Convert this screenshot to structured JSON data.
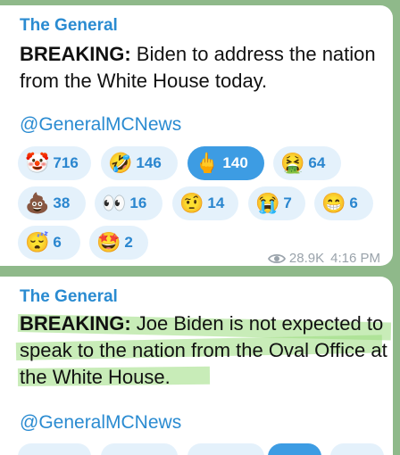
{
  "messages": [
    {
      "author": "The General",
      "text_bold": "BREAKING:",
      "text_rest": " Biden to address the nation from the White House today.",
      "handle": "@GeneralMCNews",
      "reactions": [
        {
          "emoji": "🤡",
          "count": "716"
        },
        {
          "emoji": "🤣",
          "count": "146"
        },
        {
          "emoji": "🖕",
          "count": "140",
          "active": true
        },
        {
          "emoji": "🤮",
          "count": "64"
        },
        {
          "emoji": "💩",
          "count": "38"
        },
        {
          "emoji": "👀",
          "count": "16"
        },
        {
          "emoji": "🤨",
          "count": "14"
        },
        {
          "emoji": "😭",
          "count": "7"
        },
        {
          "emoji": "😁",
          "count": "6"
        },
        {
          "emoji": "😴",
          "count": "6"
        },
        {
          "emoji": "🤩",
          "count": "2"
        }
      ],
      "views": "28.9K",
      "time": "4:16 PM"
    },
    {
      "author": "The General",
      "text_bold": "BREAKING:",
      "text_rest": " Joe Biden is not expected to speak to the nation from the Oval Office at the White House.",
      "handle": "@GeneralMCNews"
    }
  ],
  "colors": {
    "accent": "#2a8bd1",
    "reaction_bg": "#e4f1fb",
    "reaction_active": "#3d9ce3",
    "highlight": "#9bdc7d",
    "background": "#8fb98a"
  }
}
